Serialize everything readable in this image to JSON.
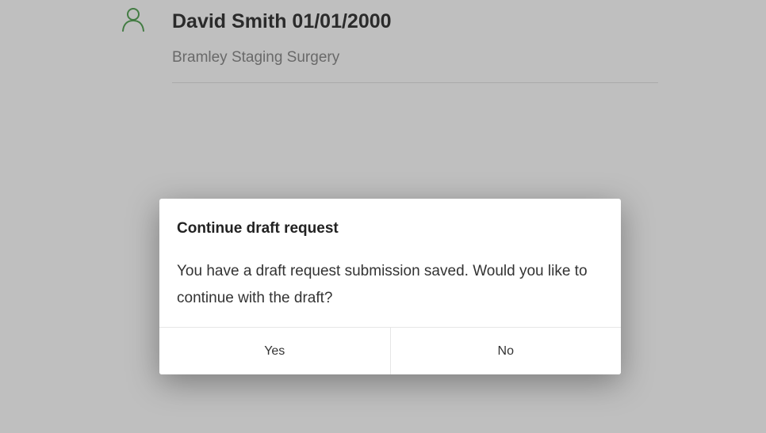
{
  "patient": {
    "name_dob": "David Smith 01/01/2000",
    "surgery": "Bramley Staging Surgery",
    "icon": "person-icon"
  },
  "dialog": {
    "title": "Continue draft request",
    "message": "You have a draft request submission saved. Would you like to continue with the draft?",
    "yes_label": "Yes",
    "no_label": "No"
  },
  "colors": {
    "accent_green": "#5aa65a",
    "overlay": "rgba(0,0,0,0.25)"
  }
}
